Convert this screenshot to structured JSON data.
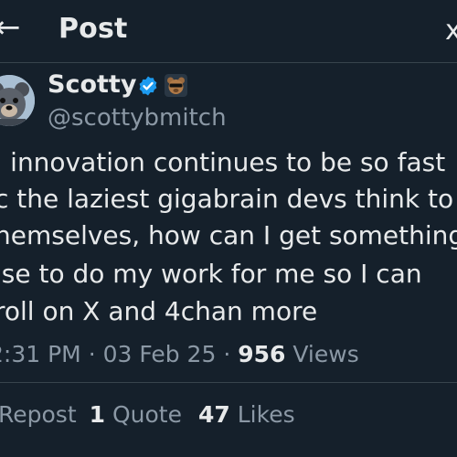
{
  "header": {
    "back_glyph": "←",
    "title": "Post",
    "close_glyph": "x"
  },
  "author": {
    "name": "Scotty",
    "handle": "@scottybmitch"
  },
  "post": {
    "lines": [
      "I innovation continues to be so fast",
      "c the laziest gigabrain devs think to",
      "hemselves, how can I get something",
      "lse to do my work for me so I can",
      "roll on X and 4chan more"
    ]
  },
  "meta": {
    "time": "2:31 PM",
    "date": "03 Feb 25",
    "separator": "·",
    "views_count": "956",
    "views_label": "Views"
  },
  "stats": {
    "repost_label": "Repost",
    "quote_count": "1",
    "quote_label": "Quote",
    "likes_count": "47",
    "likes_label": "Likes"
  },
  "colors": {
    "background": "#15202b",
    "text": "#e7e9ea",
    "muted": "#8b98a5",
    "verified_blue": "#1d9bf0"
  }
}
